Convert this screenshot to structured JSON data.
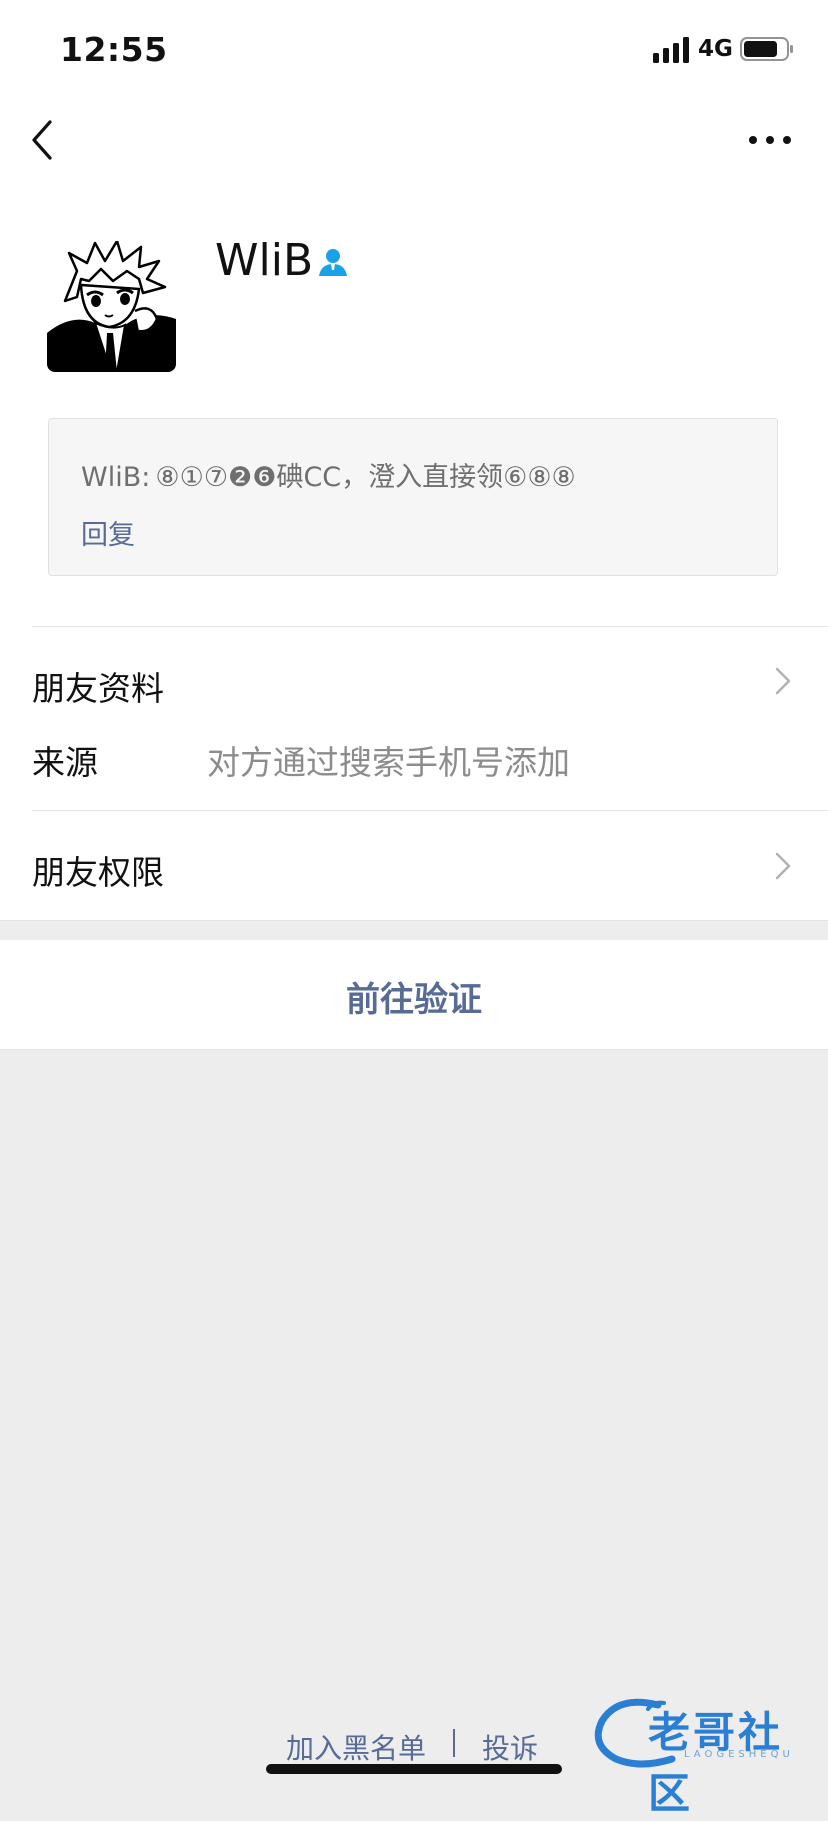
{
  "status_bar": {
    "time": "12:55",
    "network": "4G"
  },
  "profile": {
    "name": "WliB",
    "message_sender": "WliB:",
    "message_text": "⑧①⑦❷❻碘CC，澄入直接领⑥⑧⑧",
    "reply_label": "回复"
  },
  "rows": {
    "friend_info_label": "朋友资料",
    "source_label": "来源",
    "source_value": "对方通过搜索手机号添加",
    "friend_permission_label": "朋友权限"
  },
  "verify_label": "前往验证",
  "footer": {
    "blacklist_label": "加入黑名单",
    "complain_label": "投诉"
  },
  "watermark": {
    "text": "老哥社区",
    "sub": "LAOGESHEQU"
  },
  "colors": {
    "link": "#576b95",
    "accent_icon": "#1aa1e8",
    "background": "#ededed"
  }
}
